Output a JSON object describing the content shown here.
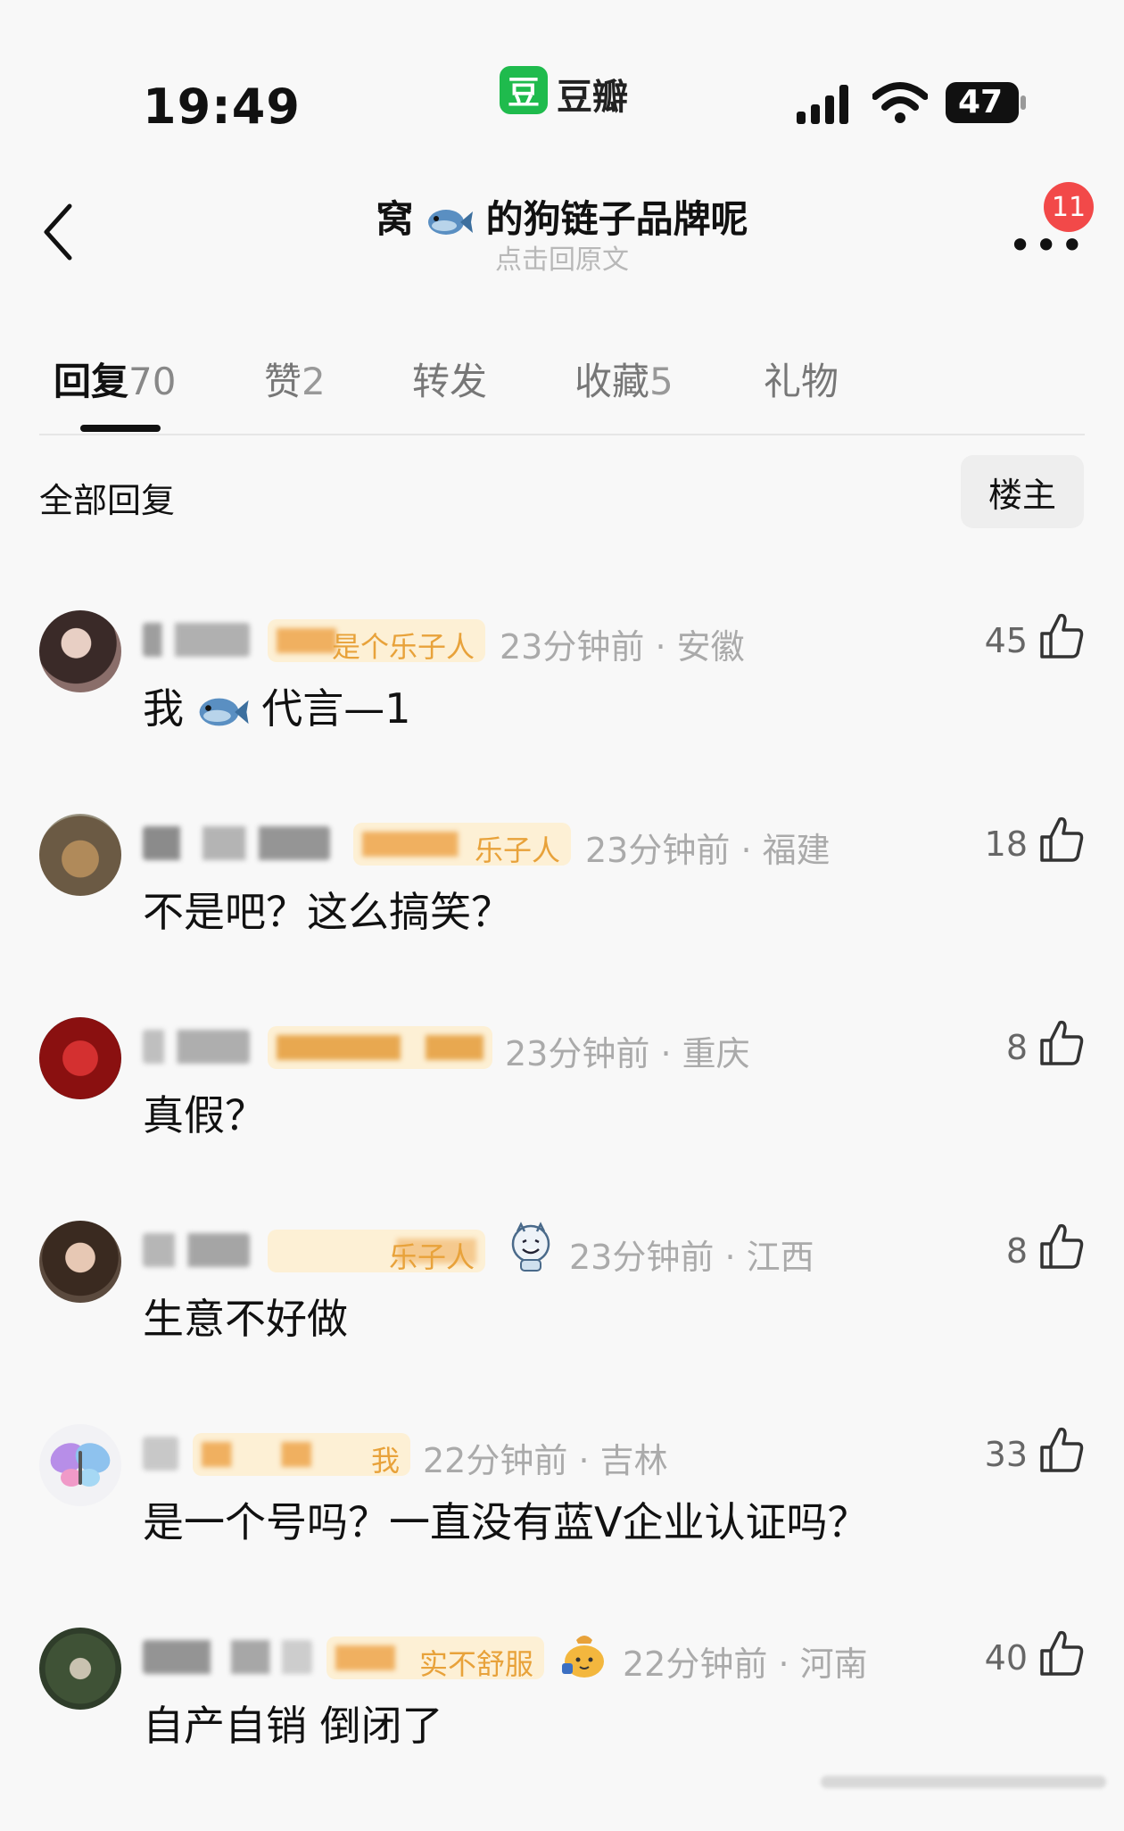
{
  "status_bar": {
    "time": "19:49",
    "app_logo_char": "豆",
    "app_name": "豆瓣",
    "battery": "47"
  },
  "header": {
    "title_prefix": "窝",
    "title_suffix": "的狗链子品牌呢",
    "subtitle": "点击回原文",
    "notification_count": "11",
    "more_label": "•••"
  },
  "tabs": [
    {
      "label": "回复",
      "count": "70"
    },
    {
      "label": "赞",
      "count": "2"
    },
    {
      "label": "转发",
      "count": ""
    },
    {
      "label": "收藏",
      "count": "5"
    },
    {
      "label": "礼物",
      "count": ""
    }
  ],
  "section": {
    "title": "全部回复",
    "filter_button": "楼主"
  },
  "comments": [
    {
      "badge_tail": "是个乐子人",
      "time": "23分钟前",
      "location": "安徽",
      "likes": "45",
      "text_before_icon": "我",
      "text_after_icon": "代言—1",
      "avatar_color": "#8a6e6a"
    },
    {
      "badge_tail": "乐子人",
      "time": "23分钟前",
      "location": "福建",
      "likes": "18",
      "text": "不是吧？这么搞笑？",
      "avatar_color": "#7a6a52"
    },
    {
      "badge_tail": "",
      "time": "23分钟前",
      "location": "重庆",
      "likes": "8",
      "text": "真假？",
      "avatar_color": "#a01818"
    },
    {
      "badge_tail": "乐子人",
      "time": "23分钟前",
      "location": "江西",
      "likes": "8",
      "text": "生意不好做",
      "avatar_color": "#5b4a3e"
    },
    {
      "badge_tail": "我",
      "time": "22分钟前",
      "location": "吉林",
      "likes": "33",
      "text": "是一个号吗？一直没有蓝V企业认证吗？",
      "avatar_color": "#f2f2f5"
    },
    {
      "badge_tail": "实不舒服",
      "time": "22分钟前",
      "location": "河南",
      "likes": "40",
      "text": "自产自销 倒闭了",
      "avatar_color": "#2f3d2a"
    }
  ],
  "colors": {
    "accent_green": "#1fbb4d",
    "badge_red": "#f24949",
    "badge_gold": "#e8a23a"
  }
}
